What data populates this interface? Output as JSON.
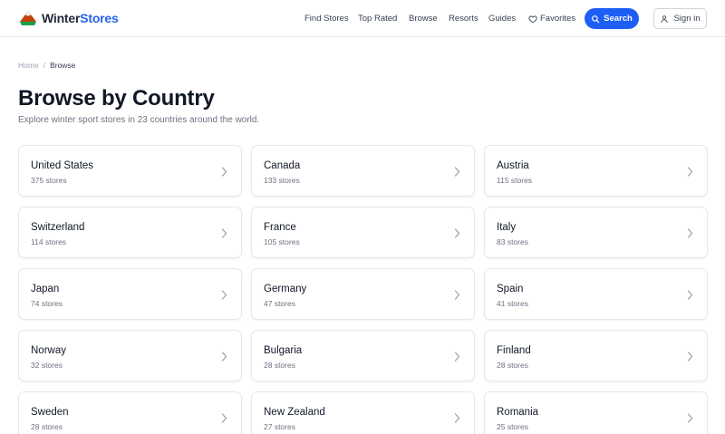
{
  "brand": {
    "part1": "Winter",
    "part2": "Stores"
  },
  "nav": {
    "find_stores": "Find Stores",
    "top_rated": "Top Rated",
    "browse": "Browse",
    "resorts": "Resorts",
    "guides": "Guides",
    "favorites": "Favorites"
  },
  "actions": {
    "search": "Search",
    "sign_in": "Sign in"
  },
  "breadcrumb": {
    "home": "Home",
    "separator": "/",
    "current": "Browse"
  },
  "page": {
    "title": "Browse by Country",
    "subtitle": "Explore winter sport stores in 23 countries around the world."
  },
  "countries": [
    {
      "name": "United States",
      "count": "375 stores"
    },
    {
      "name": "Canada",
      "count": "133 stores"
    },
    {
      "name": "Austria",
      "count": "115 stores"
    },
    {
      "name": "Switzerland",
      "count": "114 stores"
    },
    {
      "name": "France",
      "count": "105 stores"
    },
    {
      "name": "Italy",
      "count": "83 stores"
    },
    {
      "name": "Japan",
      "count": "74 stores"
    },
    {
      "name": "Germany",
      "count": "47 stores"
    },
    {
      "name": "Spain",
      "count": "41 stores"
    },
    {
      "name": "Norway",
      "count": "32 stores"
    },
    {
      "name": "Bulgaria",
      "count": "28 stores"
    },
    {
      "name": "Finland",
      "count": "28 stores"
    },
    {
      "name": "Sweden",
      "count": "28 stores"
    },
    {
      "name": "New Zealand",
      "count": "27 stores"
    },
    {
      "name": "Romania",
      "count": "25 stores"
    }
  ],
  "colors": {
    "accent": "#1d5ff5",
    "brand_blue": "#2563eb",
    "text": "#111827",
    "muted": "#6b7280"
  },
  "icons": {
    "logo": "mountain-logo-icon",
    "favorites": "heart-icon",
    "search": "search-icon",
    "sign_in": "user-icon",
    "card": "chevron-right-icon"
  }
}
